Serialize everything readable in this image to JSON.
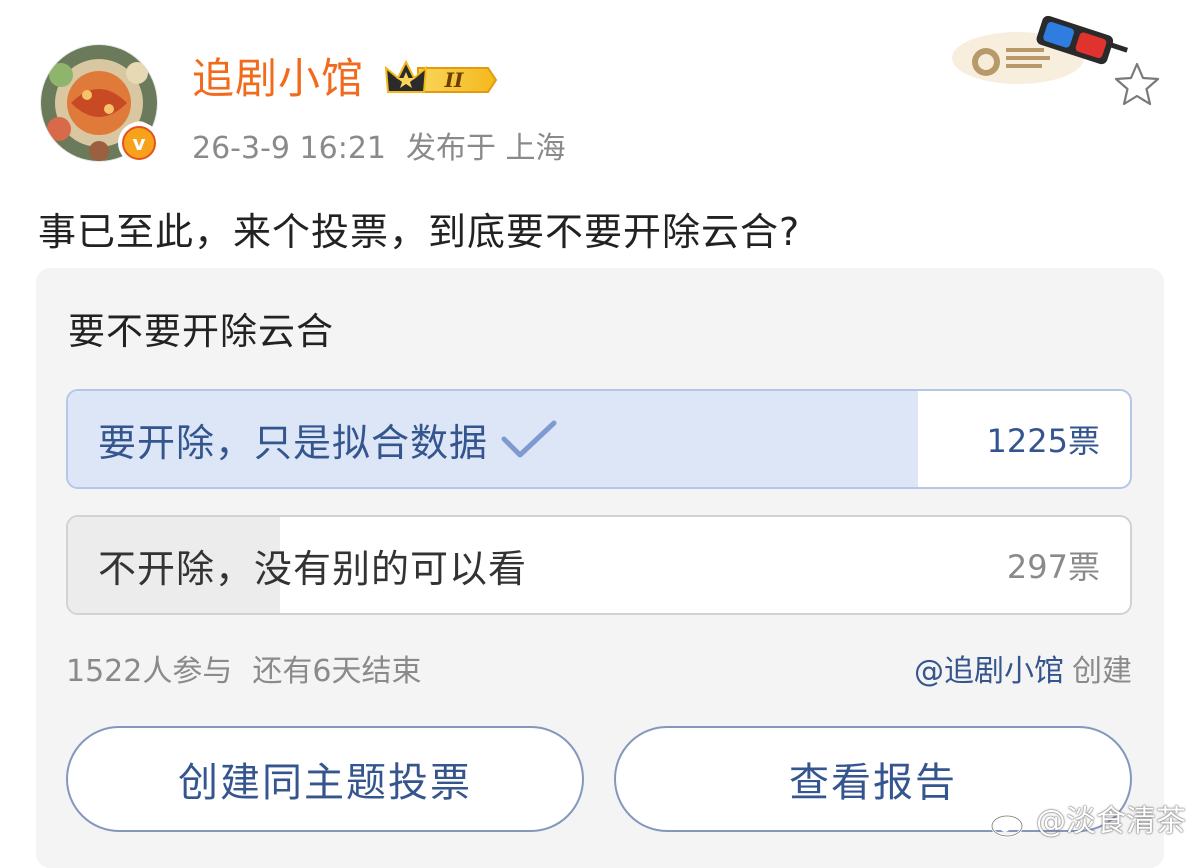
{
  "post": {
    "author": "追剧小馆",
    "level_badge": "II",
    "time": "26-3-9 16:21",
    "location": "发布于 上海",
    "text": "事已至此，来个投票，到底要不要开除云合?"
  },
  "vote": {
    "title": "要不要开除云合",
    "options": [
      {
        "label": "要开除，只是拟合数据",
        "count": "1225票",
        "share": 0.8,
        "selected": true
      },
      {
        "label": "不开除，没有别的可以看",
        "count": "297票",
        "share": 0.2,
        "selected": false
      }
    ],
    "participants": "1522人参与",
    "remaining": "还有6天结束",
    "creator": "@追剧小馆",
    "creator_action": "创建",
    "buttons": {
      "create_same": "创建同主题投票",
      "view_report": "查看报告"
    }
  },
  "watermark": "@淡食清茶",
  "icons": {
    "verified": "verified-v-icon",
    "level": "crown-level-icon",
    "favorite": "star-icon",
    "check": "checkmark-icon",
    "decoration": "3d-glasses-badge-icon"
  },
  "colors": {
    "username": "#f26b1d",
    "accent_blue": "#34558e",
    "selected_fill": "#dce6f6",
    "unselected_fill": "#ececec"
  }
}
